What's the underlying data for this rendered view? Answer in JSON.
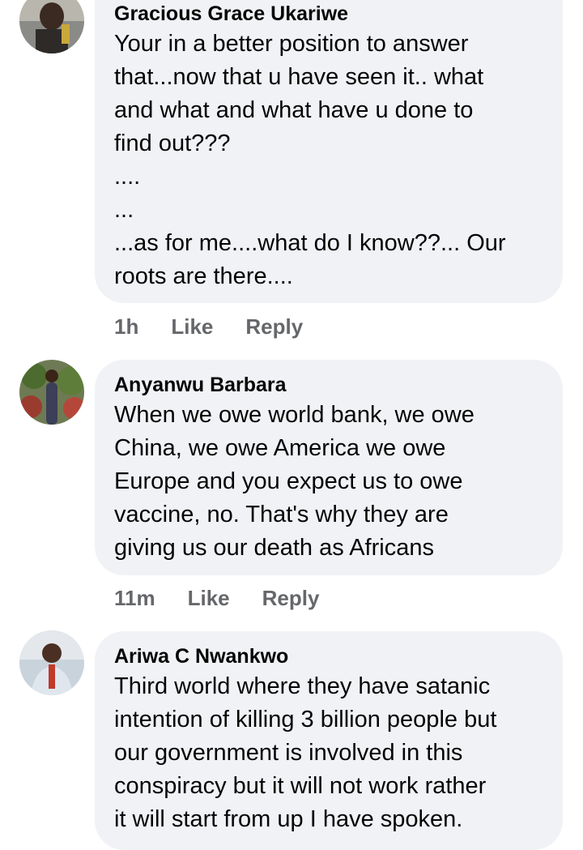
{
  "comments": [
    {
      "author": "Gracious Grace Ukariwe",
      "text": "Your in a better position to answer\nthat...now that u have seen it.. what\nand what and what have u done to\nfind out???\n....\n...\n...as for me....what do I know??... Our\nroots are there....",
      "time": "1h",
      "like_label": "Like",
      "reply_label": "Reply"
    },
    {
      "author": "Anyanwu Barbara",
      "text": "When we owe world bank, we owe\nChina, we owe America we owe\nEurope and you expect us to owe\nvaccine, no. That's why they are\ngiving us our death as Africans",
      "time": "11m",
      "like_label": "Like",
      "reply_label": "Reply"
    },
    {
      "author": "Ariwa C Nwankwo",
      "text": "Third world where they have satanic\nintention of killing 3 billion people but\nour government is involved in this\nconspiracy but it will not work rather\nit will start from up I have spoken.",
      "time": "",
      "like_label": "",
      "reply_label": ""
    }
  ],
  "colors": {
    "bubble": "#f0f2f5",
    "text": "#050505",
    "meta": "#65676b"
  }
}
